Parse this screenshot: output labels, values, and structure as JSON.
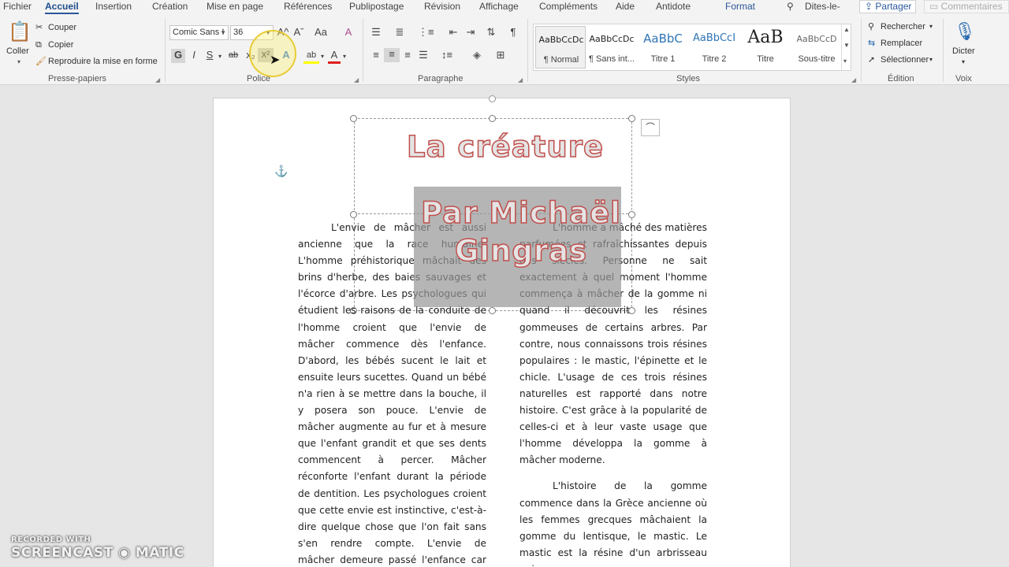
{
  "tabs": [
    "Fichier",
    "Accueil",
    "Insertion",
    "Création",
    "Mise en page",
    "Références",
    "Publipostage",
    "Révision",
    "Affichage",
    "Compléments",
    "Aide",
    "Antidote",
    "Format"
  ],
  "tell_me": "Dites-le-",
  "share_label": "Partager",
  "comments_label": "Commentaires",
  "clipboard": {
    "paste_label": "Coller",
    "cut_label": "Couper",
    "copy_label": "Copier",
    "format_painter_label": "Reproduire la mise en forme",
    "group_label": "Presse-papiers"
  },
  "font": {
    "font_name": "Comic Sans I",
    "font_size": "36",
    "group_label": "Police",
    "bold_glyph": "G",
    "italic_glyph": "I",
    "underline_glyph": "S",
    "strike_glyph": "ab",
    "subscript_glyph": "x₂",
    "superscript_glyph": "x²",
    "effects_glyph": "A",
    "highlight_glyph": "ab",
    "color_glyph": "A",
    "grow_glyph": "A^",
    "shrink_glyph": "Aˇ",
    "case_glyph": "Aa",
    "clear_glyph": "A",
    "highlight_color": "#ffff00",
    "font_color": "#e02020",
    "effects_color": "#3b7dd8"
  },
  "paragraph": {
    "group_label": "Paragraphe",
    "pilcrow": "¶"
  },
  "styles": {
    "group_label": "Styles",
    "items": [
      {
        "preview": "AaBbCcDc",
        "name": "¶ Normal"
      },
      {
        "preview": "AaBbCcDc",
        "name": "¶ Sans int..."
      },
      {
        "preview": "AaBbC",
        "name": "Titre 1"
      },
      {
        "preview": "AaBbCcI",
        "name": "Titre 2"
      },
      {
        "preview": "AaB",
        "name": "Titre"
      },
      {
        "preview": "AaBbCcD",
        "name": "Sous-titre"
      }
    ]
  },
  "editing": {
    "group_label": "Édition",
    "find_label": "Rechercher",
    "replace_label": "Remplacer",
    "select_label": "Sélectionner"
  },
  "voice": {
    "dictate_label": "Dicter",
    "group_label": "Voix"
  },
  "document": {
    "title": "La créature",
    "author": "Par Michaël Gingras",
    "left_column": "L'envie de mâcher est aussi ancienne que la race humaine. L'homme préhistorique mâchait des brins d'herbe, des baies sauvages et l'écorce d'arbre. Les psychologues qui étudient les raisons de la conduite de l'homme croient que l'envie de mâcher commence dès l'enfance. D'abord, les bébés sucent le lait et ensuite leurs sucettes. Quand un bébé n'a rien à se mettre dans la bouche, il y posera son pouce. L'envie de mâcher augmente au fur et à mesure que l'enfant grandit et que ses dents commencent à percer. Mâcher réconforte l'enfant durant la période de dentition. Les psychologues croient que cette envie est instinctive, c'est-à-dire quelque chose que l'on fait sans s'en rendre compte. L'envie de mâcher demeure passé l'enfance car mâcher rafraîchit la bouche et semble",
    "right_column_p1": "L'homme a mâché des matières parfumées et rafraîchissantes depuis des siècles. Personne ne sait exactement à quel moment l'homme commença à mâcher de la gomme ni quand il découvrit les résines gommeuses de certains arbres. Par contre, nous connaissons trois résines populaires : le mastic, l'épinette et le chicle. L'usage de ces trois résines naturelles est rapporté dans notre histoire. C'est grâce à la popularité de celles-ci et à leur vaste usage que l'homme développa la gomme à mâcher moderne.",
    "right_column_p2": "L'histoire de la gomme commence dans la Grèce ancienne où les femmes grecques mâchaient la gomme du lentisque, le mastic. Le mastic est la résine d'un arbrisseau qui"
  },
  "watermark": {
    "line1": "RECORDED WITH",
    "line2": "SCREENCAST ◉ MATIC"
  },
  "colors": {
    "accent": "#2b579a",
    "title_outline": "#c0504d"
  }
}
